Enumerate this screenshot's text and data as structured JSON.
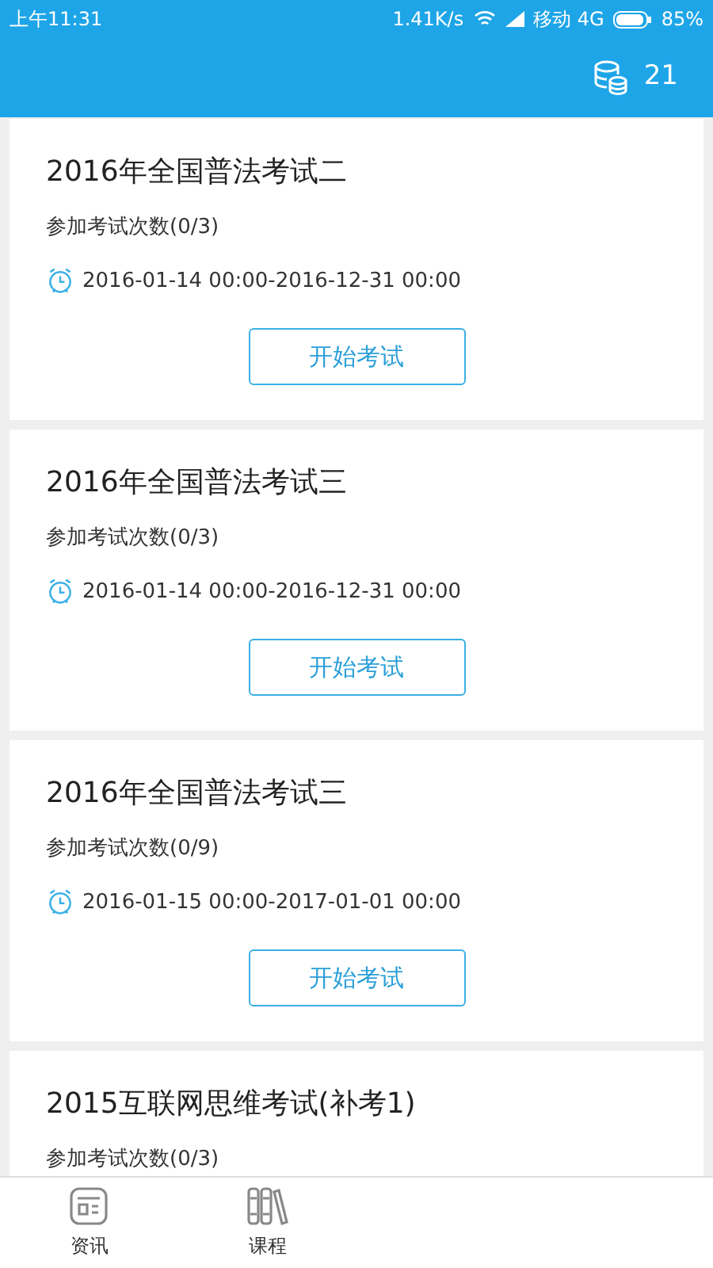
{
  "status_bar": {
    "time": "上午11:31",
    "speed": "1.41K/s",
    "carrier": "移动 4G",
    "battery": "85%"
  },
  "header": {
    "coins": "21"
  },
  "exams": [
    {
      "title": "2016年全国普法考试二",
      "attempts": "参加考试次数(0/3)",
      "period": "2016-01-14 00:00-2016-12-31 00:00",
      "button": "开始考试"
    },
    {
      "title": "2016年全国普法考试三",
      "attempts": "参加考试次数(0/3)",
      "period": "2016-01-14 00:00-2016-12-31 00:00",
      "button": "开始考试"
    },
    {
      "title": "2016年全国普法考试三",
      "attempts": "参加考试次数(0/9)",
      "period": "2016-01-15 00:00-2017-01-01 00:00",
      "button": "开始考试"
    },
    {
      "title": "2015互联网思维考试(补考1)",
      "attempts": "参加考试次数(0/3)"
    }
  ],
  "nav": [
    {
      "kind": "news",
      "label": "资讯"
    },
    {
      "kind": "course",
      "label": "课程"
    }
  ]
}
